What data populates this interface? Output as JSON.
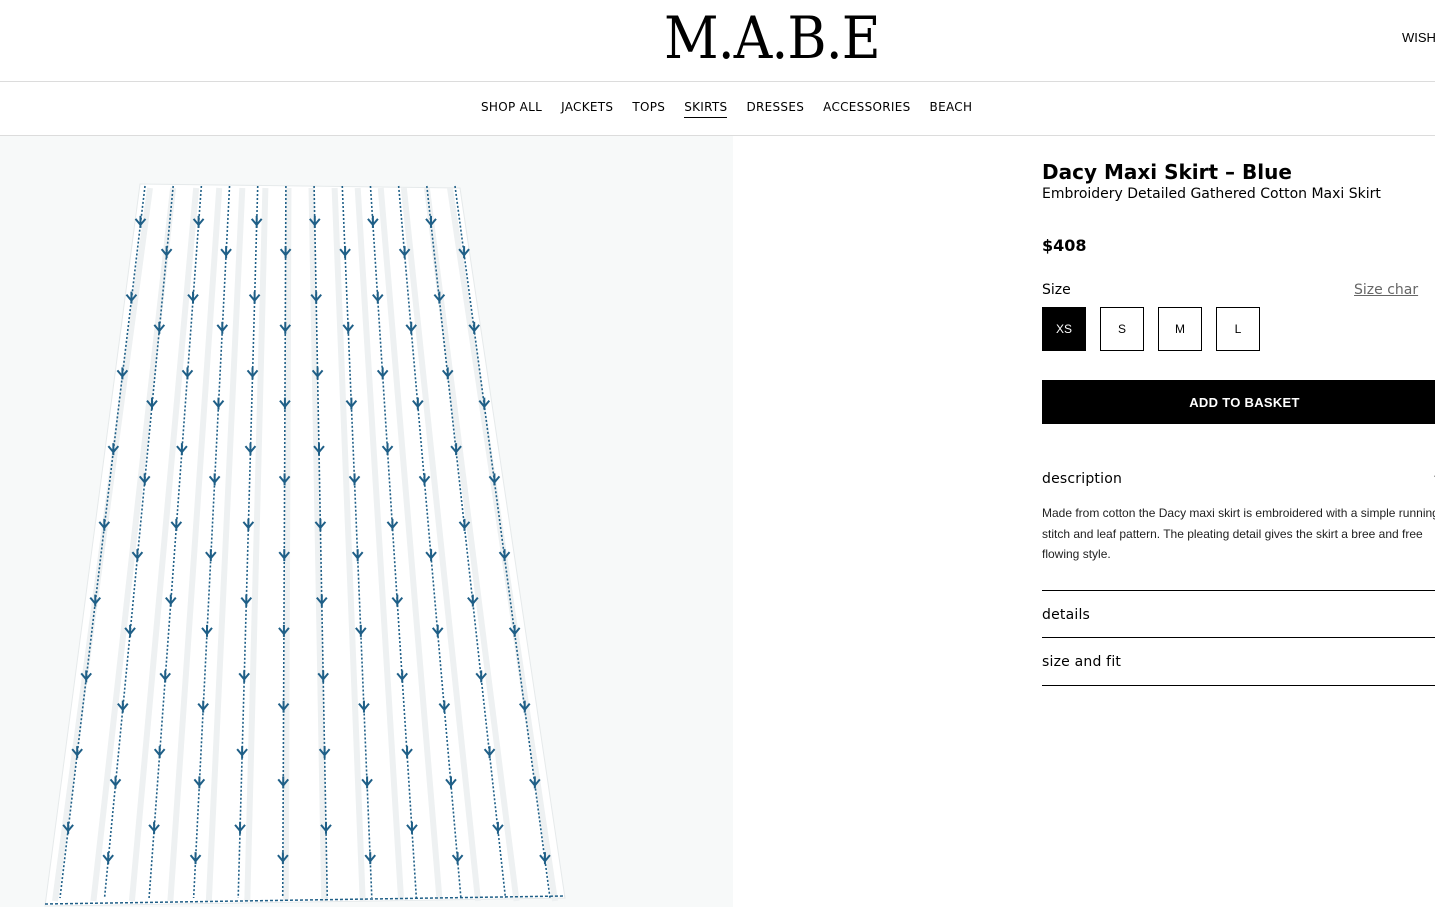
{
  "header": {
    "logo": "M.A.B.E",
    "wishlist": "WISH"
  },
  "nav": {
    "items": [
      "SHOP ALL",
      "JACKETS",
      "TOPS",
      "SKIRTS",
      "DRESSES",
      "ACCESSORIES",
      "BEACH"
    ],
    "active": "SKIRTS"
  },
  "product": {
    "title": "Dacy Maxi Skirt – Blue",
    "subtitle": "Embroidery Detailed Gathered Cotton Maxi Skirt",
    "price": "$408",
    "size_label": "Size",
    "size_chart": "Size char",
    "sizes": [
      "XS",
      "S",
      "M",
      "L"
    ],
    "selected_size": "XS",
    "add_to_basket": "ADD TO BASKET"
  },
  "accordion": {
    "description_label": "description",
    "description_text": "Made from cotton the Dacy maxi skirt is embroidered with a simple running stitch and leaf pattern. The pleating detail gives the skirt a bree and free flowing style.",
    "details_label": "details",
    "size_fit_label": "size and fit"
  },
  "colors": {
    "embroidery": "#1f5f87",
    "fabric": "#ffffff",
    "background": "#f7f9f9"
  }
}
